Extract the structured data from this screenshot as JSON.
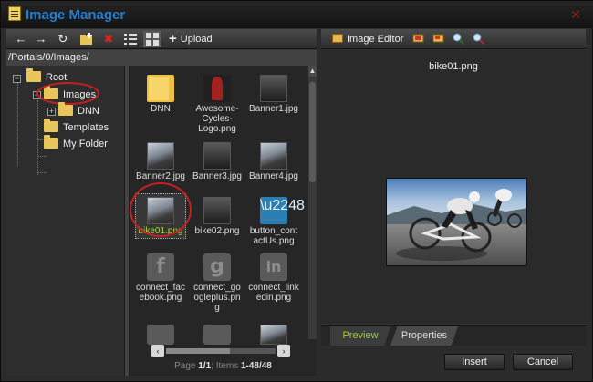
{
  "window": {
    "title": "Image Manager"
  },
  "toolbar": {
    "upload_label": "Upload"
  },
  "path": "/Portals/0/Images/",
  "tree": {
    "root": "Root",
    "images": "Images",
    "dnn": "DNN",
    "templates": "Templates",
    "my_folder": "My Folder"
  },
  "files": [
    {
      "label": "DNN",
      "kind": "folder"
    },
    {
      "label": "Awesome-Cycles-Logo.png",
      "kind": "logo"
    },
    {
      "label": "Banner1.jpg",
      "kind": "photo"
    },
    {
      "label": "Banner2.jpg",
      "kind": "photo"
    },
    {
      "label": "Banner3.jpg",
      "kind": "photo"
    },
    {
      "label": "Banner4.jpg",
      "kind": "photo"
    },
    {
      "label": "bike01.png",
      "kind": "photo"
    },
    {
      "label": "bike02.png",
      "kind": "photo"
    },
    {
      "label": "button_contactUs.png",
      "kind": "button"
    },
    {
      "label": "connect_facebook.png",
      "kind": "social"
    },
    {
      "label": "connect_googleplus.png",
      "kind": "social"
    },
    {
      "label": "connect_linkedin.png",
      "kind": "social"
    }
  ],
  "file_wrapped": {
    "f1": "Awesome-\nCycles-\nLogo.png",
    "f8": "button_cont\nactUs.png",
    "f9": "connect_fac\nebook.png",
    "f10": "connect_go\nogleplus.pn\ng",
    "f11": "connect_link\nedin.png"
  },
  "social_glyphs": {
    "facebook": "f",
    "googleplus": "g",
    "linkedin": "in"
  },
  "pager": {
    "prefix": "Page ",
    "page": "1/1",
    "items_label": "; Items ",
    "items": "1-48/48"
  },
  "preview": {
    "editor_label": "Image Editor",
    "filename": "bike01.png",
    "tab_preview": "Preview",
    "tab_properties": "Properties",
    "insert": "Insert",
    "cancel": "Cancel"
  },
  "colors": {
    "title": "#1f7fd0",
    "selected_text": "#9fd02e",
    "highlight": "#c62020"
  },
  "icons": {
    "back": "arrow-left-icon",
    "forward": "arrow-right-icon",
    "refresh": "refresh-icon",
    "new_folder": "new-folder-icon",
    "delete": "delete-icon",
    "list_view": "list-view-icon",
    "thumb_view": "thumbnail-view-icon",
    "zoom_in": "zoom-in-icon",
    "zoom_out": "zoom-out-icon"
  }
}
